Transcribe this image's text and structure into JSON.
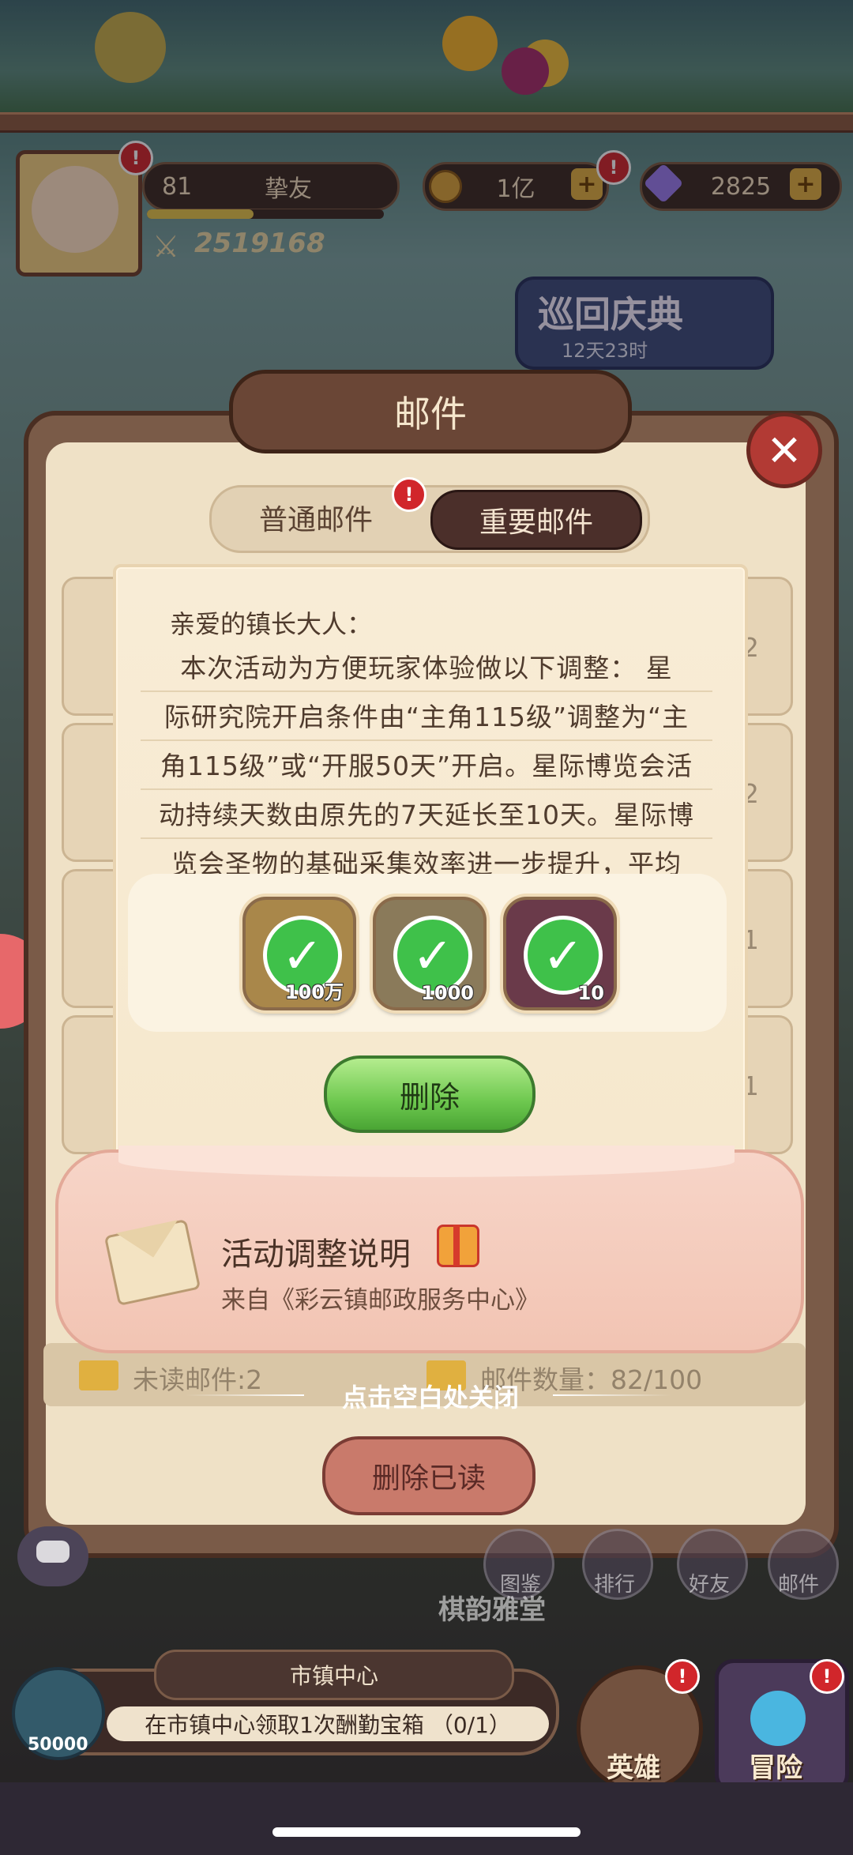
{
  "hud": {
    "level": "81",
    "player_name": "挚友",
    "gold": "1亿",
    "gems": "2825",
    "power": "2519168",
    "badge_mark": "!",
    "plus_mark": "+"
  },
  "event_banner": {
    "title": "巡回庆典",
    "timer": "12天23时"
  },
  "mail_panel": {
    "title": "邮件",
    "close_mark": "✕",
    "tab_normal": "普通邮件",
    "tab_important": "重要邮件",
    "row_counts": [
      "2",
      "2",
      "1",
      "1"
    ],
    "unread_label": "未读邮件:2",
    "count_label": "邮件数量：82/100",
    "delete_read_label": "删除已读"
  },
  "letter": {
    "greeting": "亲爱的镇长大人：",
    "lines": [
      "本次活动为方便玩家体验做以下调整： 星",
      "际研究院开启条件由“主角115级”调整为“主",
      "角115级”或“开服50天”开启。星际博览会活",
      "动持续天数由原先的7天延长至10天。星际博",
      "览会圣物的基础采集效率进一步提升，平均"
    ],
    "rewards": [
      {
        "name": "gold-reward",
        "qty": "100万",
        "color": "#a9874a"
      },
      {
        "name": "book-reward",
        "qty": "1000",
        "color": "#8a7a5a"
      },
      {
        "name": "crystal-reward",
        "qty": "10",
        "color": "#6a3a4a"
      }
    ],
    "check_mark": "✓",
    "delete_label": "删除"
  },
  "mail_card": {
    "title": "活动调整说明",
    "from": "来自《彩云镇邮政服务中心》"
  },
  "close_hint": "点击空白处关闭",
  "town": {
    "label": "市镇中心",
    "task": "在市镇中心领取1次酬勤宝箱 （0/1）",
    "bottle_value": "50000"
  },
  "nav": {
    "hero": "英雄",
    "adventure": "冒险",
    "side": [
      "图鉴",
      "排行",
      "好友",
      "邮件"
    ],
    "hall": "棋韵雅堂"
  }
}
